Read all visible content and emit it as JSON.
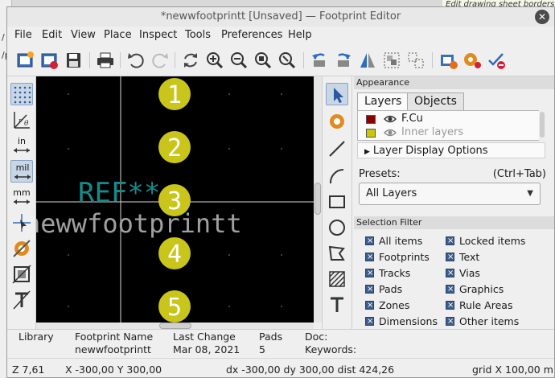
{
  "window": {
    "title": "*newwfootprintt [Unsaved] — Footprint Editor",
    "close_glyph": "✕"
  },
  "background_hint": "Edit drawing sheet borders and title block",
  "menu": [
    "File",
    "Edit",
    "View",
    "Place",
    "Inspect",
    "Tools",
    "Preferences",
    "Help"
  ],
  "toolbar_icons": [
    "new-footprint-icon",
    "save-library-icon",
    "save-icon",
    "print-icon",
    "undo-icon",
    "redo-icon",
    "refresh-icon",
    "zoom-in-icon",
    "zoom-out-icon",
    "zoom-fit-icon",
    "zoom-area-icon",
    "rotate-ccw-icon",
    "rotate-cw-icon",
    "mirror-icon",
    "group-icon",
    "ungroup-icon",
    "footprint-properties-icon",
    "pad-settings-icon",
    "check-footprint-icon"
  ],
  "left_toolbar": {
    "units_in": "in",
    "units_mil": "mil",
    "units_mm": "mm",
    "icons": [
      "grid-icon",
      "polar-coords-icon",
      "inches-icon",
      "mils-icon",
      "millimeters-icon",
      "full-crosshair-icon",
      "high-contrast-icon",
      "pad-outline-icon",
      "text-outline-icon"
    ]
  },
  "canvas": {
    "ref_text": "REF**",
    "value_text": "newwfootprintt",
    "pads": [
      "1",
      "2",
      "3",
      "4",
      "5"
    ],
    "colors": {
      "background": "#000000",
      "pad": "#c9c51a",
      "ref": "#158b8b",
      "value": "#a0a0a0"
    }
  },
  "right_toolbar": [
    "select-icon",
    "pad-icon",
    "line-icon",
    "arc-icon",
    "rectangle-icon",
    "circle-icon",
    "polygon-icon",
    "hatch-icon",
    "text-icon"
  ],
  "appearance": {
    "header": "Appearance",
    "tabs": [
      "Layers",
      "Objects"
    ],
    "active_tab": "Layers",
    "layers": [
      {
        "name": "F.Cu",
        "color": "#8b0000"
      },
      {
        "name": "Inner layers",
        "color": "#c9c70a"
      }
    ],
    "layer_display_options": "Layer Display Options",
    "presets_label": "Presets:",
    "presets_shortcut": "(Ctrl+Tab)",
    "presets_value": "All Layers"
  },
  "selection_filter": {
    "header": "Selection Filter",
    "items_left": [
      "All items",
      "Footprints",
      "Tracks",
      "Pads",
      "Zones",
      "Dimensions"
    ],
    "items_right": [
      "Locked items",
      "Text",
      "Vias",
      "Graphics",
      "Rule Areas",
      "Other items"
    ]
  },
  "info": {
    "library_label": "Library",
    "footprint_name_label": "Footprint Name",
    "footprint_name": "newwfootprintt",
    "last_change_label": "Last Change",
    "last_change": "Mar 08, 2021",
    "pads_label": "Pads",
    "pads": "5",
    "doc_label": "Doc:",
    "keywords_label": "Keywords:"
  },
  "status": {
    "zoom": "Z 7,61",
    "cursor": "X -300,00  Y 300,00",
    "delta": "dx -300,00  dy 300,00  dist 424,26",
    "grid": "grid X 100,00 m"
  }
}
